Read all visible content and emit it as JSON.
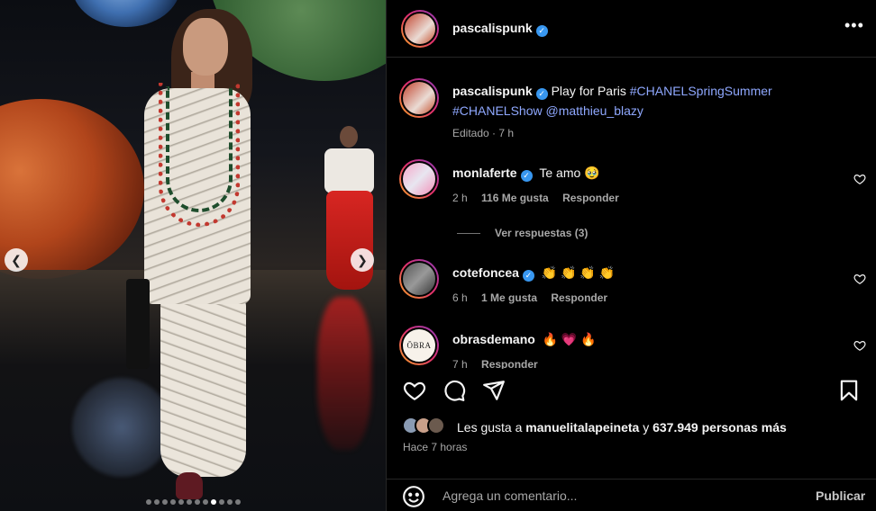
{
  "post": {
    "username": "pascalispunk",
    "verified": true,
    "more_icon": "more-horizontal-icon",
    "media": {
      "slide_count": 12,
      "active_slide": 9,
      "prev_icon": "chevron-left-icon",
      "next_icon": "chevron-right-icon",
      "prev_glyph": "❮",
      "next_glyph": "❯"
    }
  },
  "caption": {
    "username": "pascalispunk",
    "text": "Play for Paris",
    "hashtags": [
      "#CHANELSpringSummer",
      "#CHANELShow"
    ],
    "mention": "@matthieu_blazy",
    "meta": "Editado · 7 h"
  },
  "comments": [
    {
      "username": "monlaferte",
      "verified": true,
      "text": "Te amo 🥹",
      "time": "2 h",
      "likes": "116 Me gusta",
      "reply": "Responder",
      "view_replies": "Ver respuestas (3)"
    },
    {
      "username": "cotefoncea",
      "verified": true,
      "text": "👏 👏 👏 👏",
      "time": "6 h",
      "likes": "1 Me gusta",
      "reply": "Responder"
    },
    {
      "username": "obrasdemano",
      "verified": false,
      "text": "🔥 💗 🔥",
      "time": "7 h",
      "reply": "Responder",
      "avatar_text": "ŌBRA"
    }
  ],
  "actions": {
    "like_icon": "heart-icon",
    "comment_icon": "comment-icon",
    "share_icon": "share-icon",
    "save_icon": "bookmark-icon"
  },
  "likes": {
    "prefix": "Les gusta a",
    "user": "manuelitalapeineta",
    "joiner": "y",
    "others": "637.949 personas más"
  },
  "time_ago": "Hace 7 horas",
  "add_comment": {
    "placeholder": "Agrega un comentario...",
    "publish": "Publicar",
    "emoji_icon": "emoji-icon"
  },
  "colors": {
    "background": "#000000",
    "text": "#f5f5f5",
    "muted": "#a8a8a8",
    "link": "#8fa8ff",
    "verified": "#3897f0"
  }
}
